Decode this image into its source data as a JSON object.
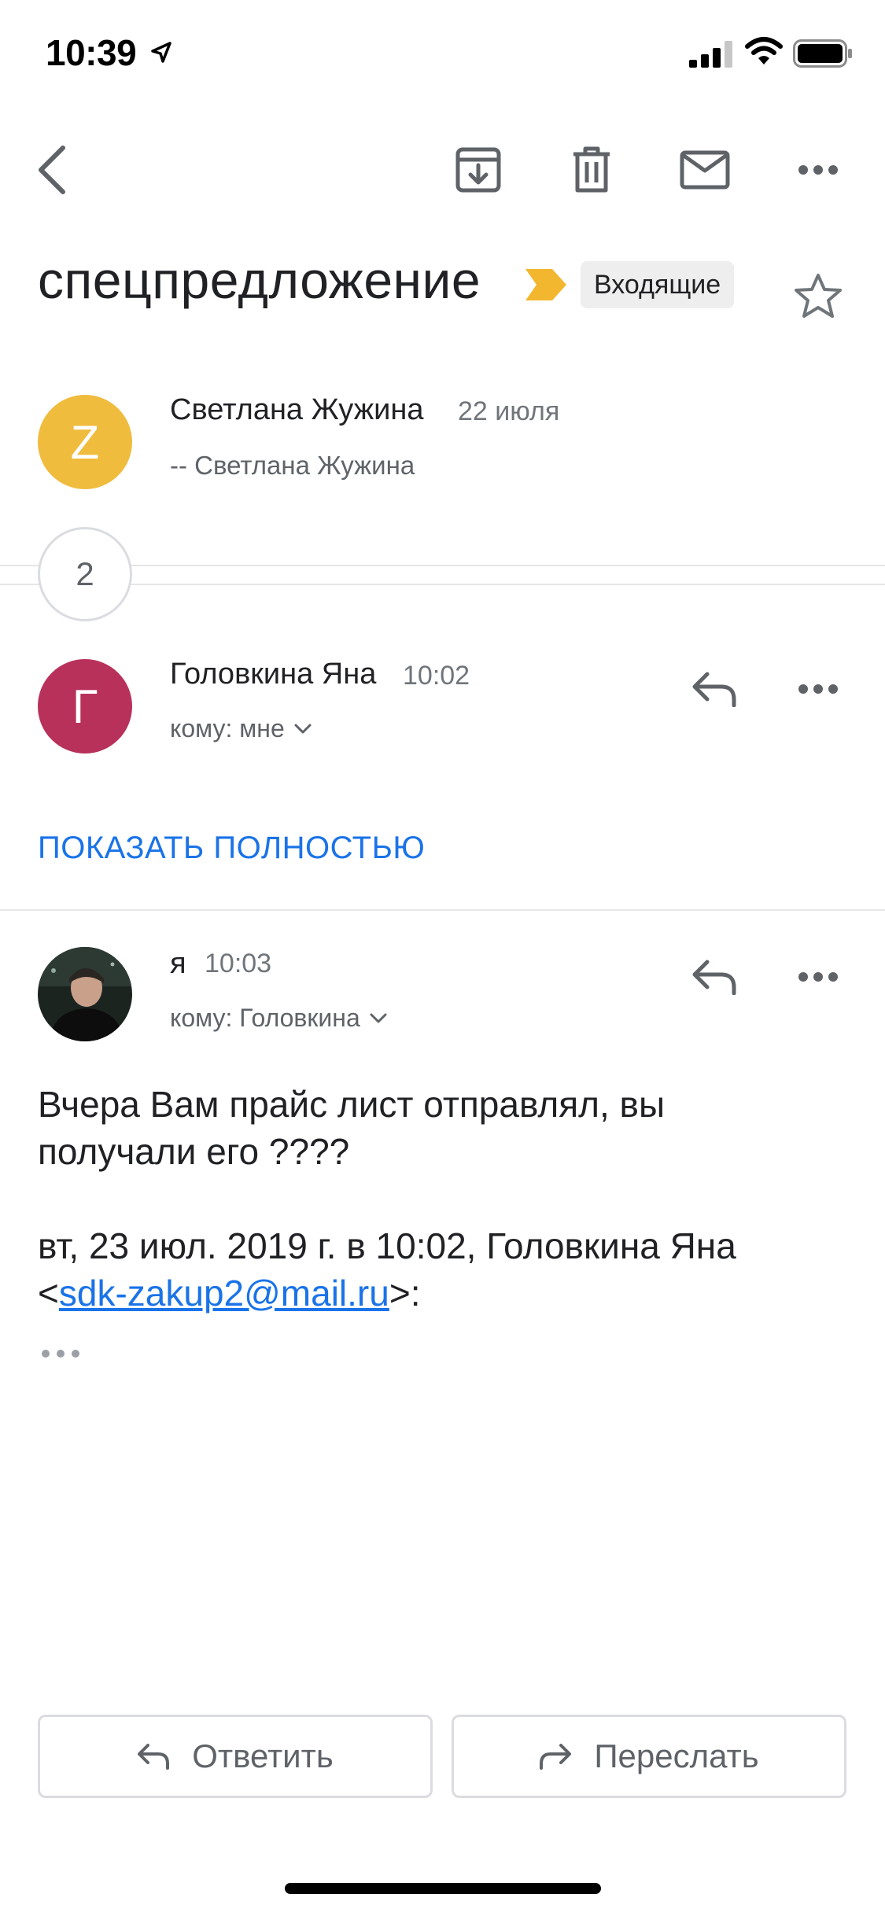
{
  "status_bar": {
    "time": "10:39"
  },
  "toolbar": {
    "back_icon": "chevron-left-icon",
    "archive_icon": "archive-icon",
    "delete_icon": "trash-icon",
    "mark_unread_icon": "envelope-icon",
    "more_icon": "more-horizontal-icon"
  },
  "thread": {
    "subject": "спецпредложение",
    "label": "Входящие",
    "important_color": "#f2b72f"
  },
  "messages": [
    {
      "avatar_letter": "Z",
      "avatar_color": "#f0bc3e",
      "sender": "Светлана Жужина",
      "time": "22 июля",
      "snippet": "-- Светлана Жужина"
    },
    {
      "avatar_letter": "Г",
      "avatar_color": "#b8315a",
      "sender": "Головкина Яна",
      "time": "10:02",
      "recipient": "кому: мне"
    },
    {
      "sender": "я",
      "time": "10:03",
      "recipient": "кому: Головкина",
      "body_line1": "Вчера Вам прайс лист отправлял, вы",
      "body_line2": "получали его ????",
      "quote_line1": "вт, 23 июл. 2019 г. в 10:02, Головкина Яна",
      "quote_email": "sdk-zakup2@mail.ru",
      "quote_open": "<",
      "quote_close": ">:"
    }
  ],
  "collapsed_count": "2",
  "show_all": "ПОКАЗАТЬ ПОЛНОСТЬЮ",
  "actions": {
    "reply": "Ответить",
    "forward": "Переслать"
  },
  "colors": {
    "link": "#1a73e8",
    "divider": "#e6e6e6"
  }
}
